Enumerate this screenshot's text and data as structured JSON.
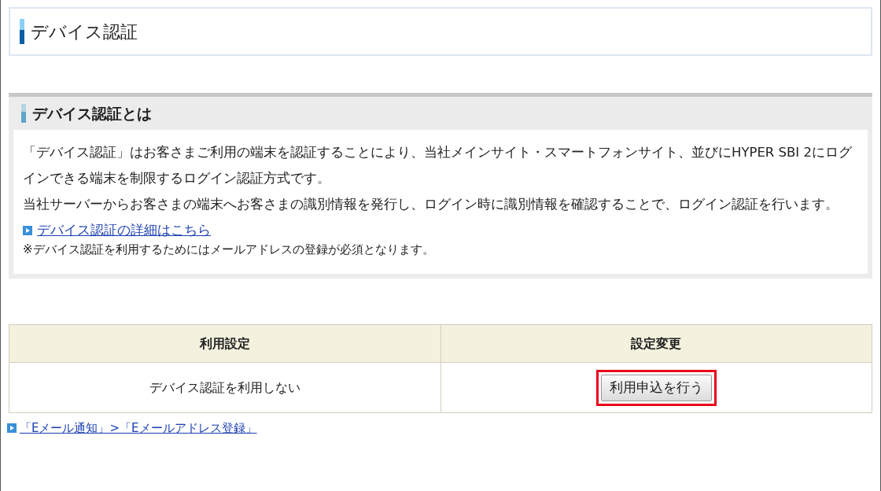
{
  "page_title": "デバイス認証",
  "section": {
    "heading": "デバイス認証とは",
    "paragraphs": [
      "「デバイス認証」はお客さまご利用の端末を認証することにより、当社メインサイト・スマートフォンサイト、並びにHYPER SBI 2にログインできる端末を制限するログイン認証方式です。",
      "当社サーバーからお客さまの端末へお客さまの識別情報を発行し、ログイン時に識別情報を確認することで、ログイン認証を行います。"
    ],
    "link": "デバイス認証の詳細はこちら",
    "note": "※デバイス認証を利用するためにはメールアドレスの登録が必須となります。"
  },
  "table": {
    "columns": [
      "利用設定",
      "設定変更"
    ],
    "rows": [
      {
        "status": "デバイス認証を利用しない",
        "button": {
          "label": "利用申込を行う",
          "highlighted": true
        }
      }
    ]
  },
  "footer_link": "「Eメール通知」>「Eメールアドレス登録」"
}
